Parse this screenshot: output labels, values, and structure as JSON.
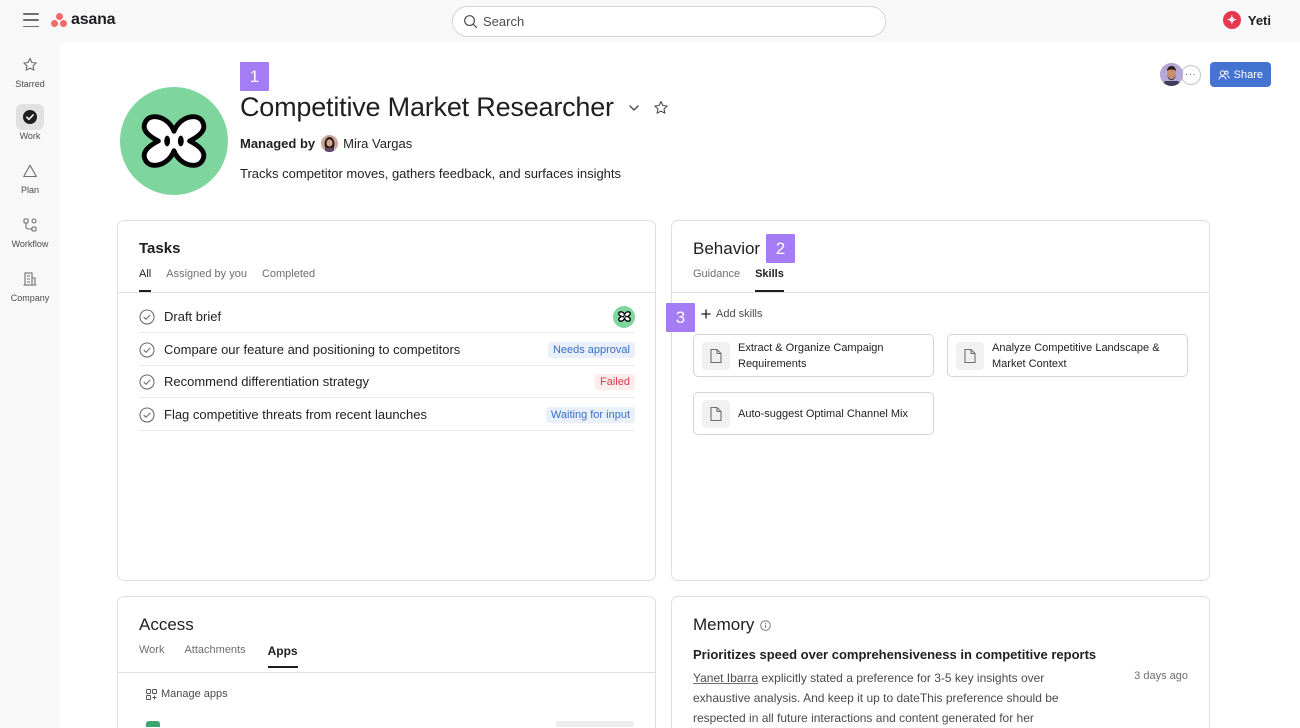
{
  "topbar": {
    "logo_text": "asana",
    "search_placeholder": "Search",
    "user_name": "Yeti"
  },
  "rail": [
    {
      "label": "Starred",
      "icon": "star-icon"
    },
    {
      "label": "Work",
      "icon": "check-circle-icon",
      "active": true
    },
    {
      "label": "Plan",
      "icon": "triangle-icon"
    },
    {
      "label": "Workflow",
      "icon": "workflow-icon"
    },
    {
      "label": "Company",
      "icon": "building-icon"
    }
  ],
  "markers": [
    "1",
    "2",
    "3"
  ],
  "agent": {
    "title": "Competitive Market Researcher",
    "managed_by_label": "Managed by",
    "manager_name": "Mira Vargas",
    "description": "Tracks competitor moves, gathers feedback, and surfaces insights"
  },
  "header": {
    "more_label": "···",
    "share_label": "Share"
  },
  "tasks": {
    "title": "Tasks",
    "tabs": [
      "All",
      "Assigned by you",
      "Completed"
    ],
    "rows": [
      {
        "name": "Draft brief",
        "status": "",
        "status_kind": "agent"
      },
      {
        "name": "Compare our feature and positioning to competitors",
        "status": "Needs approval",
        "status_kind": "approval"
      },
      {
        "name": "Recommend differentiation strategy",
        "status": "Failed",
        "status_kind": "failed"
      },
      {
        "name": "Flag competitive threats from recent launches",
        "status": "Waiting for input",
        "status_kind": "waiting"
      }
    ]
  },
  "behavior": {
    "title": "Behavior",
    "tabs": [
      "Guidance",
      "Skills"
    ],
    "add_skills_label": "Add skills",
    "skills": [
      "Extract & Organize Campaign Requirements",
      "Analyze Competitive Landscape & Market Context",
      "Auto-suggest Optimal Channel Mix"
    ]
  },
  "access": {
    "title": "Access",
    "tabs": [
      "Work",
      "Attachments",
      "Apps"
    ],
    "manage_apps_label": "Manage apps"
  },
  "memory": {
    "title": "Memory",
    "item_title": "Prioritizes speed over comprehensiveness in competitive reports",
    "item_time": "3 days ago",
    "item_author": "Yanet Ibarra",
    "item_body": " explicitly stated a preference for 3-5 key insights over exhaustive analysis. And keep it up to dateThis preference should be respected in all future interactions and content generated for her"
  },
  "colors": {
    "brand": "#f06a6a",
    "agent_avatar": "#7ed59e",
    "share_button": "#4573d2",
    "marker": "#a47cf3"
  }
}
